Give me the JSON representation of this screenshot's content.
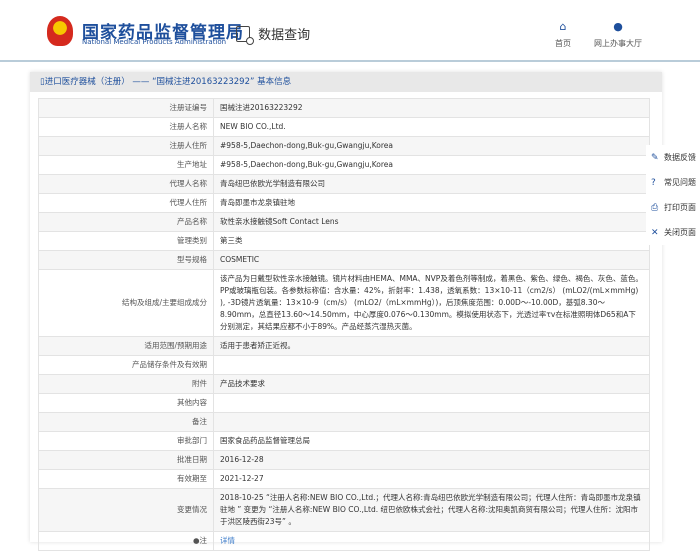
{
  "header": {
    "brand_cn": "国家药品监督管理局",
    "brand_en": "National Medical Products Administration",
    "query": "数据查询",
    "nav": [
      {
        "label": "首页",
        "icon": "home-icon"
      },
      {
        "label": "网上办事大厅",
        "icon": "user-icon"
      }
    ]
  },
  "panel": {
    "title": "进口医疗器械（注册） —— “国械注进20163223292” 基本信息"
  },
  "rows": [
    {
      "label": "注册证编号",
      "value": "国械注进20163223292"
    },
    {
      "label": "注册人名称",
      "value": "NEW BIO CO.,Ltd."
    },
    {
      "label": "注册人住所",
      "value": "#958-5,Daechon-dong,Buk-gu,Gwangju,Korea"
    },
    {
      "label": "生产地址",
      "value": "#958-5,Daechon-dong,Buk-gu,Gwangju,Korea"
    },
    {
      "label": "代理人名称",
      "value": "青岛纽巴依欧光学制造有限公司"
    },
    {
      "label": "代理人住所",
      "value": "青岛即墨市龙泉镇驻地"
    },
    {
      "label": "产品名称",
      "value": "软性亲水接触镜Soft Contact Lens"
    },
    {
      "label": "管理类别",
      "value": "第三类"
    },
    {
      "label": "型号规格",
      "value": "COSMETIC"
    },
    {
      "label": "结构及组成/主要组成成分",
      "value": "该产品为日戴型软性亲水接触镜。镜片材料由HEMA、MMA、NVP及着色剂等制成，着黑色、紫色、绿色、褐色、灰色、蓝色。PP或玻璃瓶包装。各参数标称值：含水量：42%，折射率：1.438，透氧系数：13×10-11（cm2/s） (mLO2/(mL×mmHg) ), -3D镜片透氧量：13×10-9（cm/s） (mLO2/（mL×mmHg）)，后顶焦度范围：0.00D～-10.00D，基弧8.30～8.90mm，总直径13.60～14.50mm，中心厚度0.076～0.130mm。模拟使用状态下，光透过率τv在标准照明体D65和A下分别测定，其结果应都不小于89%。产品经蒸汽湿热灭菌。"
    },
    {
      "label": "适用范围/预期用途",
      "value": "适用于患者矫正近视。"
    },
    {
      "label": "产品储存条件及有效期",
      "value": ""
    },
    {
      "label": "附件",
      "value": "产品技术要求"
    },
    {
      "label": "其他内容",
      "value": ""
    },
    {
      "label": "备注",
      "value": ""
    },
    {
      "label": "审批部门",
      "value": "国家食品药品监督管理总局"
    },
    {
      "label": "批准日期",
      "value": "2016-12-28"
    },
    {
      "label": "有效期至",
      "value": "2021-12-27"
    },
    {
      "label": "变更情况",
      "value": "2018-10-25 “注册人名称:NEW BIO CO.,Ltd.；代理人名称:青岛纽巴依欧光学制造有限公司；代理人住所：青岛即墨市龙泉镇驻地 ” 变更为 “注册人名称:NEW BIO CO.,Ltd. 纽巴依欧株式会社；代理人名称:沈阳奥凯商贸有限公司；代理人住所：沈阳市于洪区陵西街23号” 。"
    }
  ],
  "note": {
    "label": "注",
    "link": "详情"
  },
  "sidebar": [
    {
      "label": "数据反馈",
      "icon": "edit-icon"
    },
    {
      "label": "常见问题",
      "icon": "question-icon"
    },
    {
      "label": "打印页面",
      "icon": "print-icon"
    },
    {
      "label": "关闭页面",
      "icon": "close-icon"
    }
  ],
  "sidebar_glyphs": [
    "✎",
    "?",
    "⎙",
    "✕"
  ]
}
